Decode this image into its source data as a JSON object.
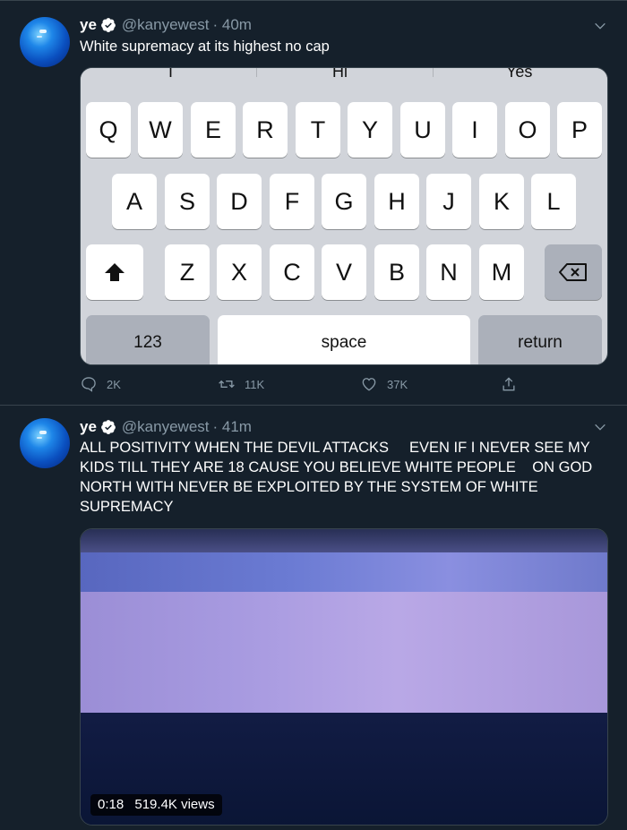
{
  "tweets": [
    {
      "name": "ye",
      "handle": "@kanyewest",
      "time": "· 40m",
      "text": "White supremacy at its highest no cap",
      "keyboard": {
        "suggestions": [
          "I",
          "Hi",
          "Yes"
        ],
        "row1": [
          "Q",
          "W",
          "E",
          "R",
          "T",
          "Y",
          "U",
          "I",
          "O",
          "P"
        ],
        "row2": [
          "A",
          "S",
          "D",
          "F",
          "G",
          "H",
          "J",
          "K",
          "L"
        ],
        "row3": [
          "shift-icon",
          "Z",
          "X",
          "C",
          "V",
          "B",
          "N",
          "M",
          "backspace-icon"
        ],
        "row4": [
          "123",
          "space",
          "return"
        ]
      },
      "actions": {
        "replies": "2K",
        "retweets": "11K",
        "likes": "37K"
      }
    },
    {
      "name": "ye",
      "handle": "@kanyewest",
      "time": "· 41m",
      "text": "ALL POSITIVITY WHEN THE DEVIL ATTACKS     EVEN IF I NEVER SEE MY KIDS TILL THEY ARE 18 CAUSE YOU BELIEVE WHITE PEOPLE    ON GOD NORTH WITH NEVER BE EXPLOITED BY THE SYSTEM OF WHITE SUPREMACY",
      "video": {
        "duration": "0:18",
        "views": "519.4K views"
      }
    }
  ],
  "colors": {
    "background": "#15202b",
    "secondary_text": "#8899a6",
    "divider": "#38444d"
  }
}
